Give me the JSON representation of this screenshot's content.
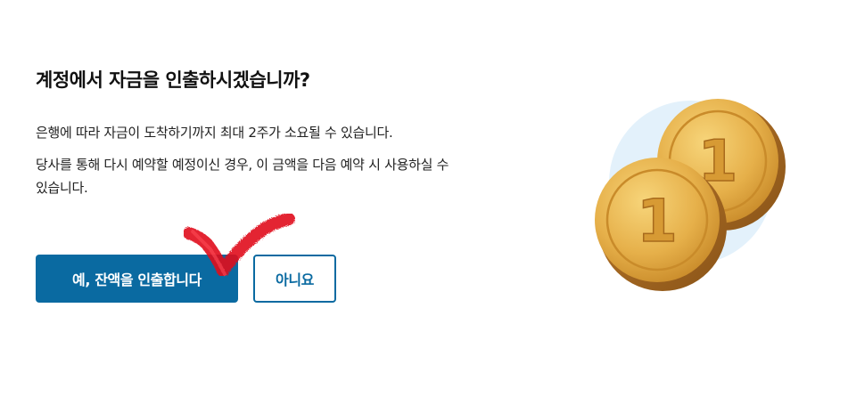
{
  "dialog": {
    "title": "계정에서 자금을 인출하시겠습니까?",
    "paragraph1": "은행에 따라 자금이 도착하기까지 최대 2주가 소요될 수 있습니다.",
    "paragraph2": "당사를 통해 다시 예약할 예정이신 경우, 이 금액을 다음 예약 시 사용하실 수 있습니다."
  },
  "actions": {
    "confirm_label": "예, 잔액을 인출합니다",
    "cancel_label": "아니요"
  },
  "illustration": {
    "coin_numeral_front": "1",
    "coin_numeral_back": "1",
    "coin_color": "#e2ab3e",
    "backdrop_color": "#e3f1fb"
  },
  "colors": {
    "accent": "#0a6aa1",
    "checkmark": "#e0111e"
  }
}
